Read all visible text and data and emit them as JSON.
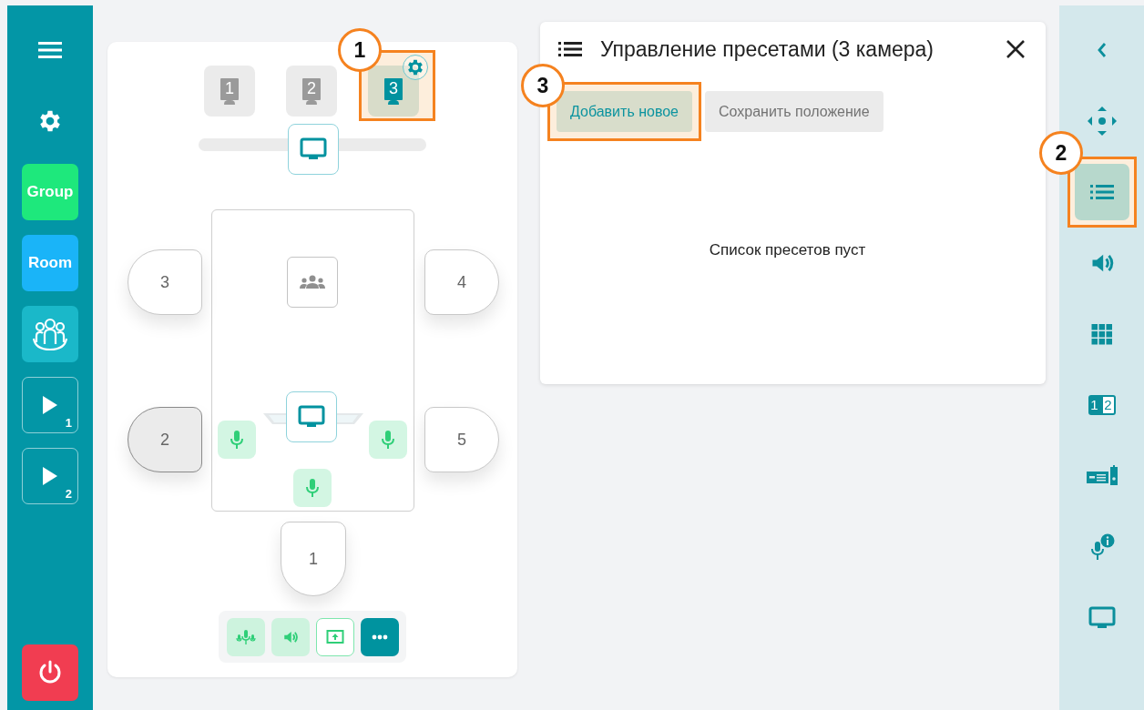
{
  "left_sidebar": {
    "items": [
      {
        "kind": "menu"
      },
      {
        "kind": "settings"
      },
      {
        "kind": "label",
        "label": "Group",
        "color": "#1ee87c"
      },
      {
        "kind": "label",
        "label": "Room",
        "color": "#1ab4f8"
      },
      {
        "kind": "participants"
      },
      {
        "kind": "play",
        "badge": "1"
      },
      {
        "kind": "play",
        "badge": "2"
      },
      {
        "kind": "power"
      }
    ]
  },
  "room": {
    "cameras": [
      {
        "label": "1",
        "selected": false,
        "highlighted": false,
        "settings_badge": false
      },
      {
        "label": "2",
        "selected": false,
        "highlighted": false,
        "settings_badge": false
      },
      {
        "label": "3",
        "selected": true,
        "highlighted": true,
        "settings_badge": true
      }
    ],
    "seats": [
      {
        "label": "3",
        "selected": false
      },
      {
        "label": "4",
        "selected": false
      },
      {
        "label": "2",
        "selected": true
      },
      {
        "label": "5",
        "selected": false
      },
      {
        "label": "1",
        "selected": false
      }
    ],
    "toolbar": [
      {
        "kind": "mic-array"
      },
      {
        "kind": "speaker"
      },
      {
        "kind": "share"
      },
      {
        "kind": "more"
      }
    ]
  },
  "preset_panel": {
    "title": "Управление пресетами (3 камера)",
    "buttons": [
      {
        "label": "Добавить новое",
        "primary": true,
        "highlighted": true
      },
      {
        "label": "Сохранить положение",
        "primary": false,
        "highlighted": false
      }
    ],
    "empty_text": "Список пресетов пуст"
  },
  "right_sidebar": {
    "items": [
      {
        "kind": "collapse",
        "selected": false,
        "highlighted": false
      },
      {
        "kind": "move",
        "selected": false,
        "highlighted": false
      },
      {
        "kind": "presets",
        "selected": true,
        "highlighted": true
      },
      {
        "kind": "volume",
        "selected": false,
        "highlighted": false
      },
      {
        "kind": "grid",
        "selected": false,
        "highlighted": false
      },
      {
        "kind": "layout",
        "digits": [
          "1",
          "2"
        ],
        "selected": false,
        "highlighted": false
      },
      {
        "kind": "device",
        "selected": false,
        "highlighted": false
      },
      {
        "kind": "mic-info",
        "selected": false,
        "highlighted": false
      },
      {
        "kind": "display",
        "selected": false,
        "highlighted": false
      }
    ]
  },
  "callouts": [
    {
      "label": "1"
    },
    {
      "label": "2"
    },
    {
      "label": "3"
    }
  ]
}
